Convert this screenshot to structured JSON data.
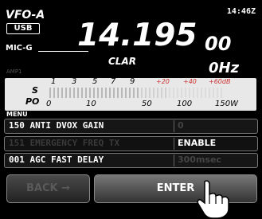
{
  "header": {
    "vfo_label": "VFO-A",
    "time": "14:46Z",
    "mode": "USB",
    "frequency_main": "14.195",
    "frequency_small": "00",
    "mic_gain_label": "MIC-G"
  },
  "clarifier": {
    "label": "CLAR",
    "value": "0Hz",
    "amp_label": "AMP1"
  },
  "meter": {
    "s_label": "S",
    "po_label": "PO",
    "s_ticks": [
      "1",
      "3",
      "5",
      "7",
      "9",
      "+20",
      "+40",
      "+60dB"
    ],
    "po_ticks": [
      "0",
      "10",
      "50",
      "100",
      "150W"
    ]
  },
  "menu": {
    "label": "MENU",
    "items": [
      {
        "name": "150 ANTI DVOX GAIN",
        "value": "0"
      },
      {
        "name": "151 EMERGENCY FREQ TX",
        "value": "ENABLE"
      },
      {
        "name": "001 AGC FAST DELAY",
        "value": "300msec"
      }
    ]
  },
  "buttons": {
    "back": "BACK",
    "enter": "ENTER"
  },
  "colors": {
    "background": "#000000",
    "meter_bg": "#e8e8e8",
    "meter_over": "#cc3333"
  },
  "icons": {
    "pointer": "hand-pointer-icon",
    "back_arrow": "arrow-right-icon"
  }
}
